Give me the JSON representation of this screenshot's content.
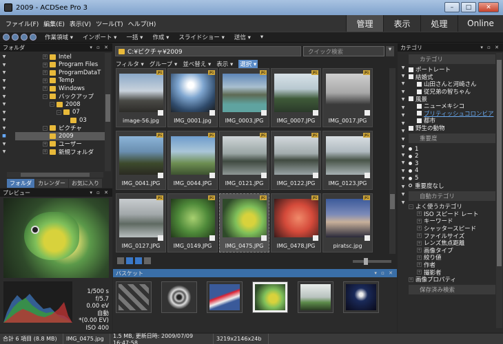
{
  "window": {
    "title": "2009 - ACDSee Pro 3",
    "min": "–",
    "max": "□",
    "close": "✕"
  },
  "menu": [
    "ファイル(F)",
    "編集(E)",
    "表示(V)",
    "ツール(T)",
    "ヘルプ(H)"
  ],
  "modes": [
    "管理",
    "表示",
    "処理",
    "Online"
  ],
  "toolbar": {
    "items": [
      "作業領域 ▾",
      "インポート ▾",
      "一括 ▾",
      "作成 ▾",
      "スライドショー ▾",
      "送信 ▾",
      "▾"
    ]
  },
  "folders": {
    "header": "フォルダ",
    "items": [
      "Intel",
      "Program Files",
      "ProgramDataT",
      "Temp",
      "Windows",
      "バックアップ",
      "2008",
      "07",
      "03",
      "ピクチャ",
      "2009",
      "ユーザー",
      "新規フォルダ"
    ],
    "tabs": [
      "フォルダ",
      "カレンダー",
      "お気に入り"
    ]
  },
  "preview": {
    "header": "プレビュー"
  },
  "exif": [
    "1/500 s",
    "f/5.7",
    "0.00 eV",
    "自動",
    "*(0.00 EV)",
    "ISO 400"
  ],
  "browser": {
    "path": "C:¥ピクチャ¥2009",
    "search_placeholder": "クイック検索",
    "filters": [
      "フィルタ ▾",
      "グループ ▾",
      "並べ替え ▾",
      "表示 ▾",
      "選択 ▾"
    ],
    "thumbs": [
      "image-56.jpg",
      "IMG_0001.jpg",
      "IMG_0003.JPG",
      "IMG_0007.JPG",
      "IMG_0017.JPG",
      "IMG_0041.JPG",
      "IMG_0044.JPG",
      "IMG_0121.JPG",
      "IMG_0122.JPG",
      "IMG_0123.JPG",
      "IMG_0127.JPG",
      "IMG_0149.JPG",
      "IMG_0475.JPG",
      "IMG_0478.JPG",
      "piratsc.jpg"
    ],
    "jpg_badge": "JPG"
  },
  "basket": {
    "header": "バスケット"
  },
  "categories": {
    "header": "カテゴリ",
    "section_category": "カテゴリ",
    "cats": [
      "ポートレート",
      "結婚式",
      "山田さんと河崎さん",
      "従兄弟の智ちゃん",
      "風景",
      "ニューメキシコ",
      "ブリティッシュコロンビア",
      "都市",
      "野生の動物"
    ],
    "section_rating": "重要度",
    "ratings": [
      "1",
      "2",
      "3",
      "4",
      "5",
      "重要度なし"
    ],
    "section_auto": "自動カテゴリ",
    "auto": [
      "よく使うカテゴリ",
      "ISO スピード レート",
      "キーワード",
      "シャッタースピード",
      "ファイルサイズ",
      "レンズ焦点距離",
      "画像タイプ",
      "絞り値",
      "作者",
      "撮影者",
      "画像プロパティ"
    ],
    "section_saved": "保存済み検索"
  },
  "status": {
    "total": "合計 6 項目 (8.8 MB)",
    "file": "IMG_0475.jpg",
    "info": "1.5 MB, 更新日時: 2009/07/09 16:47:58",
    "dims": "3219x2146x24b"
  }
}
